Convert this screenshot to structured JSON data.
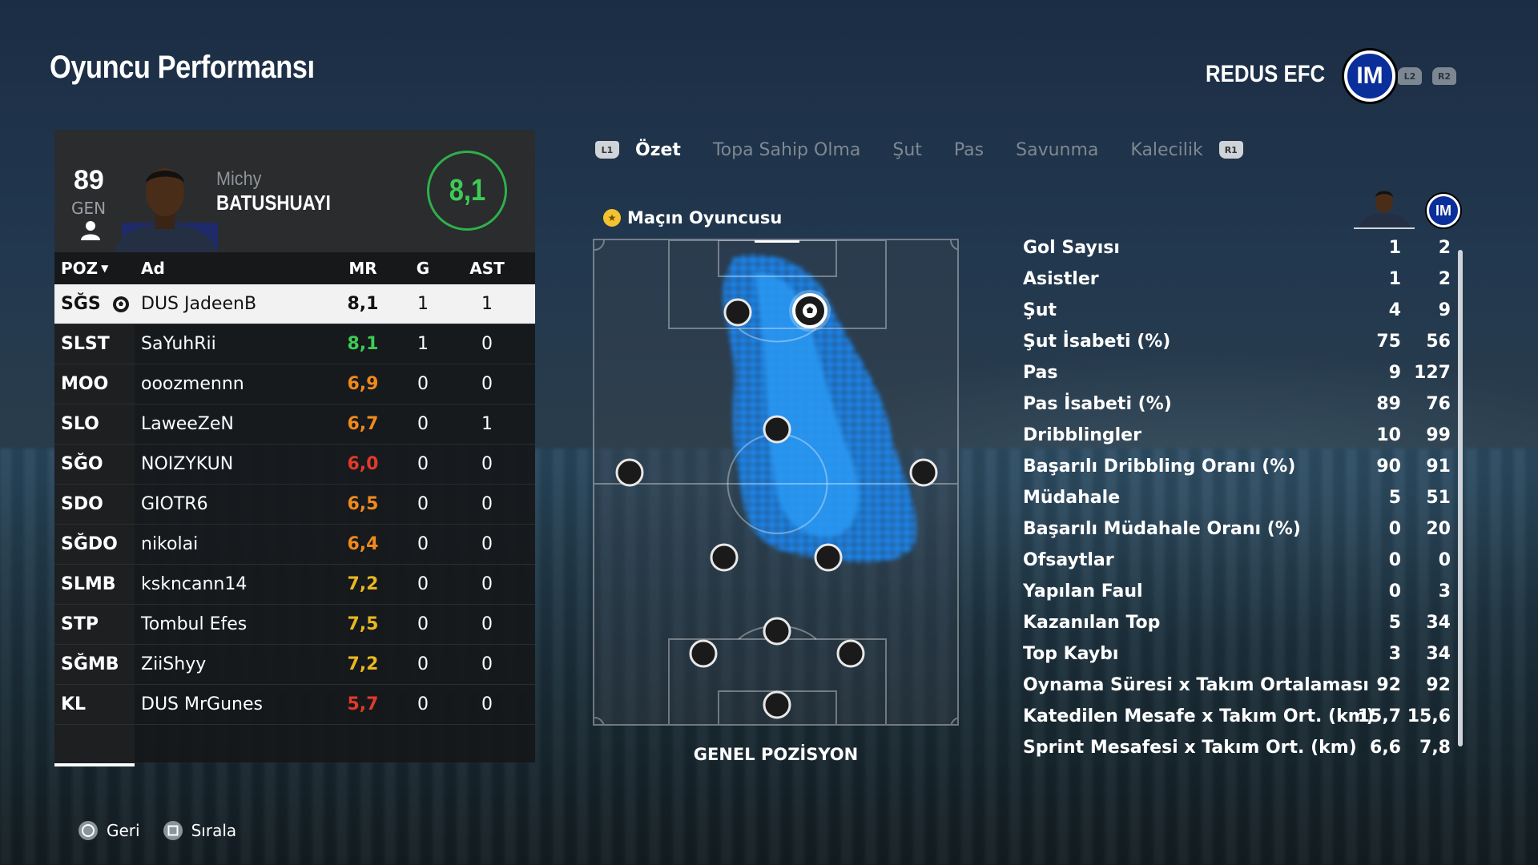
{
  "header": {
    "title": "Oyuncu Performansı",
    "team_name": "REDUS EFC",
    "crest_monogram": "IM",
    "l2_label": "L2",
    "r2_label": "R2"
  },
  "player": {
    "overall": "89",
    "overall_label": "GEN",
    "first_name": "Michy",
    "last_name": "BATUSHUAYI",
    "match_rating": "8,1"
  },
  "table": {
    "headers": {
      "poz": "POZ",
      "ad": "Ad",
      "mr": "MR",
      "g": "G",
      "ast": "AST"
    },
    "rows": [
      {
        "poz": "SĞS",
        "ad": "DUS JadeenB",
        "mr": "8,1",
        "g": "1",
        "ast": "1",
        "mr_color": "#111111",
        "selected": true,
        "motm": true
      },
      {
        "poz": "SLST",
        "ad": "SaYuhRii",
        "mr": "8,1",
        "g": "1",
        "ast": "0",
        "mr_color": "#3ecb55"
      },
      {
        "poz": "MOO",
        "ad": "ooozmennn",
        "mr": "6,9",
        "g": "0",
        "ast": "0",
        "mr_color": "#f08a1c"
      },
      {
        "poz": "SLO",
        "ad": "LaweeZeN",
        "mr": "6,7",
        "g": "0",
        "ast": "1",
        "mr_color": "#f08a1c"
      },
      {
        "poz": "SĞO",
        "ad": "NOIZYKUN",
        "mr": "6,0",
        "g": "0",
        "ast": "0",
        "mr_color": "#e23a2a"
      },
      {
        "poz": "SDO",
        "ad": "GIOTR6",
        "mr": "6,5",
        "g": "0",
        "ast": "0",
        "mr_color": "#f08a1c"
      },
      {
        "poz": "SĞDO",
        "ad": "nikolai",
        "mr": "6,4",
        "g": "0",
        "ast": "0",
        "mr_color": "#f08a1c"
      },
      {
        "poz": "SLMB",
        "ad": "kskncann14",
        "mr": "7,2",
        "g": "0",
        "ast": "0",
        "mr_color": "#e8b820"
      },
      {
        "poz": "STP",
        "ad": "Tombul Efes",
        "mr": "7,5",
        "g": "0",
        "ast": "0",
        "mr_color": "#e8b820"
      },
      {
        "poz": "SĞMB",
        "ad": "ZiiShyy",
        "mr": "7,2",
        "g": "0",
        "ast": "0",
        "mr_color": "#e8b820"
      },
      {
        "poz": "KL",
        "ad": "DUS MrGunes",
        "mr": "5,7",
        "g": "0",
        "ast": "0",
        "mr_color": "#e23a2a"
      }
    ]
  },
  "tabs": {
    "l1": "L1",
    "r1": "R1",
    "items": [
      "Özet",
      "Topa Sahip Olma",
      "Şut",
      "Pas",
      "Savunma",
      "Kalecilik"
    ],
    "active_index": 0
  },
  "motm_label": "Maçın Oyuncusu",
  "pitch_label": "GENEL POZİSYON",
  "stats": [
    {
      "label": "Gol Sayısı",
      "player": "1",
      "team": "2"
    },
    {
      "label": "Asistler",
      "player": "1",
      "team": "2"
    },
    {
      "label": "Şut",
      "player": "4",
      "team": "9"
    },
    {
      "label": "Şut İsabeti (%)",
      "player": "75",
      "team": "56"
    },
    {
      "label": "Pas",
      "player": "9",
      "team": "127"
    },
    {
      "label": "Pas İsabeti (%)",
      "player": "89",
      "team": "76"
    },
    {
      "label": "Dribblingler",
      "player": "10",
      "team": "99"
    },
    {
      "label": "Başarılı Dribbling Oranı (%)",
      "player": "90",
      "team": "91"
    },
    {
      "label": "Müdahale",
      "player": "5",
      "team": "51"
    },
    {
      "label": "Başarılı Müdahale Oranı (%)",
      "player": "0",
      "team": "20"
    },
    {
      "label": "Ofsaytlar",
      "player": "0",
      "team": "0"
    },
    {
      "label": "Yapılan Faul",
      "player": "0",
      "team": "3"
    },
    {
      "label": "Kazanılan Top",
      "player": "5",
      "team": "34"
    },
    {
      "label": "Top Kaybı",
      "player": "3",
      "team": "34"
    },
    {
      "label": "Oynama Süresi x Takım Ortalaması",
      "player": "92",
      "team": "92"
    },
    {
      "label": "Katedilen Mesafe x Takım Ort. (km)",
      "player": "15,7",
      "team": "15,6"
    },
    {
      "label": "Sprint Mesafesi x Takım Ort. (km)",
      "player": "6,6",
      "team": "7,8"
    }
  ],
  "footer": {
    "back_label": "Geri",
    "sort_label": "Sırala"
  },
  "colors": {
    "accent_green": "#3ecb55",
    "heatmap_blue": "#1e90ff",
    "crest_blue": "#0a2f9a"
  }
}
